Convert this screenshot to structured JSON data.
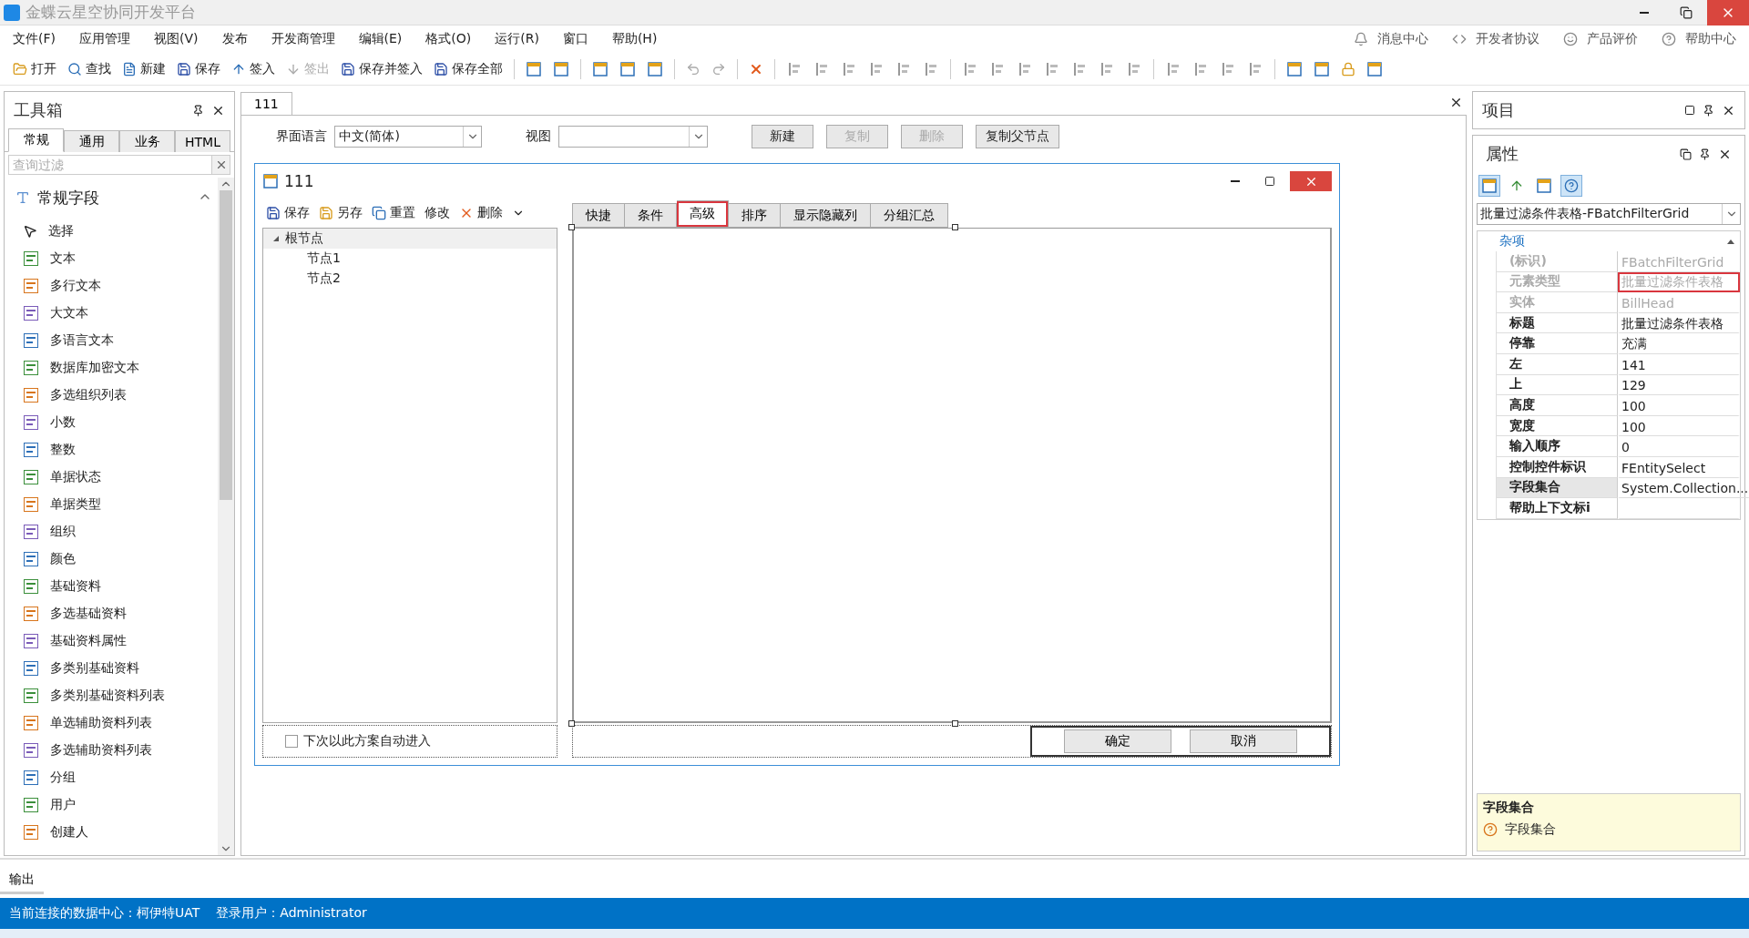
{
  "window": {
    "title": "金蝶云星空协同开发平台"
  },
  "menu": [
    "文件(F)",
    "应用管理",
    "视图(V)",
    "发布",
    "开发商管理",
    "编辑(E)",
    "格式(O)",
    "运行(R)",
    "窗口",
    "帮助(H)"
  ],
  "header_links": [
    {
      "kind": "bell",
      "label": "消息中心"
    },
    {
      "kind": "code",
      "label": "开发者协议"
    },
    {
      "kind": "smile",
      "label": "产品评价"
    },
    {
      "kind": "help",
      "label": "帮助中心"
    }
  ],
  "toolbar": [
    {
      "kind": "open",
      "label": "打开",
      "disabled": false
    },
    {
      "kind": "search",
      "label": "查找",
      "disabled": false
    },
    {
      "kind": "new",
      "label": "新建",
      "disabled": false
    },
    {
      "kind": "save",
      "label": "保存",
      "disabled": false
    },
    {
      "kind": "checkin",
      "label": "签入",
      "disabled": false
    },
    {
      "kind": "checkout",
      "label": "签出",
      "disabled": true
    },
    {
      "kind": "save",
      "label": "保存并签入",
      "disabled": false
    },
    {
      "kind": "save",
      "label": "保存全部",
      "disabled": false
    },
    {
      "kind": "separator"
    },
    {
      "kind": "icon",
      "disabled": false
    },
    {
      "kind": "icon",
      "disabled": false
    },
    {
      "kind": "separator"
    },
    {
      "kind": "icon",
      "disabled": false
    },
    {
      "kind": "icon",
      "disabled": false
    },
    {
      "kind": "icon",
      "disabled": false
    },
    {
      "kind": "separator"
    },
    {
      "kind": "undo",
      "disabled": true
    },
    {
      "kind": "redo",
      "disabled": true
    },
    {
      "kind": "separator"
    },
    {
      "kind": "delete",
      "disabled": false
    },
    {
      "kind": "separator"
    },
    {
      "kind": "align",
      "disabled": true
    },
    {
      "kind": "align",
      "disabled": true
    },
    {
      "kind": "align",
      "disabled": true
    },
    {
      "kind": "align",
      "disabled": true
    },
    {
      "kind": "align",
      "disabled": true
    },
    {
      "kind": "align",
      "disabled": true
    },
    {
      "kind": "separator"
    },
    {
      "kind": "align",
      "disabled": true
    },
    {
      "kind": "align",
      "disabled": true
    },
    {
      "kind": "align",
      "disabled": true
    },
    {
      "kind": "align",
      "disabled": true
    },
    {
      "kind": "align",
      "disabled": true
    },
    {
      "kind": "align",
      "disabled": true
    },
    {
      "kind": "align",
      "disabled": true
    },
    {
      "kind": "separator"
    },
    {
      "kind": "align",
      "disabled": true
    },
    {
      "kind": "align",
      "disabled": true
    },
    {
      "kind": "align",
      "disabled": true
    },
    {
      "kind": "align",
      "disabled": true
    },
    {
      "kind": "separator"
    },
    {
      "kind": "icon",
      "disabled": false
    },
    {
      "kind": "icon",
      "disabled": false
    },
    {
      "kind": "lock",
      "disabled": false
    },
    {
      "kind": "icon",
      "disabled": false
    }
  ],
  "toolbox": {
    "title": "工具箱",
    "tabs": [
      {
        "label": "常规",
        "selected": true
      },
      {
        "label": "通用",
        "selected": false
      },
      {
        "label": "业务",
        "selected": false
      },
      {
        "label": "HTML",
        "selected": false
      }
    ],
    "search": {
      "placeholder": "查询过滤"
    },
    "group": {
      "label": "常规字段",
      "expanded": true
    },
    "items": [
      "选择",
      "文本",
      "多行文本",
      "大文本",
      "多语言文本",
      "数据库加密文本",
      "多选组织列表",
      "小数",
      "整数",
      "单据状态",
      "单据类型",
      "组织",
      "颜色",
      "基础资料",
      "多选基础资料",
      "基础资料属性",
      "多类别基础资料",
      "多类别基础资料列表",
      "单选辅助资料列表",
      "多选辅助资料列表",
      "分组",
      "用户",
      "创建人"
    ]
  },
  "document_tab": {
    "label": "111"
  },
  "designer": {
    "language_label": "界面语言",
    "language_value": "中文(简体)",
    "view_label": "视图",
    "buttons": [
      {
        "label": "新建",
        "disabled": false
      },
      {
        "label": "复制",
        "disabled": true
      },
      {
        "label": "删除",
        "disabled": true
      },
      {
        "label": "复制父节点",
        "disabled": false
      }
    ]
  },
  "form": {
    "title": "111",
    "toolbar": [
      {
        "kind": "save",
        "label": "保存"
      },
      {
        "kind": "saveas",
        "label": "另存"
      },
      {
        "kind": "reset",
        "label": "重置"
      },
      {
        "kind": "plain",
        "label": "修改"
      },
      {
        "kind": "delete",
        "label": "删除"
      }
    ],
    "tree": {
      "label": "根节点",
      "expanded": true,
      "children": [
        {
          "label": "节点1"
        },
        {
          "label": "节点2"
        }
      ]
    },
    "tabs": [
      {
        "label": "快捷",
        "selected": false,
        "highlighted": false
      },
      {
        "label": "条件",
        "selected": false,
        "highlighted": false
      },
      {
        "label": "高级",
        "selected": true,
        "highlighted": true
      },
      {
        "label": "排序",
        "selected": false,
        "highlighted": false
      },
      {
        "label": "显示隐藏列",
        "selected": false,
        "highlighted": false
      },
      {
        "label": "分组汇总",
        "selected": false,
        "highlighted": false
      }
    ],
    "auto_enter": {
      "label": "下次以此方案自动进入",
      "checked": false
    },
    "buttons": [
      "确定",
      "取消"
    ]
  },
  "projects_panel": {
    "title": "项目"
  },
  "properties": {
    "title": "属性",
    "object": "批量过滤条件表格-FBatchFilterGrid",
    "category": {
      "label": "杂项",
      "expanded": true
    },
    "rows": [
      {
        "name": "(标识)",
        "value": "FBatchFilterGrid",
        "readonly": true,
        "selected": false,
        "highlighted": false
      },
      {
        "name": "元素类型",
        "value": "批量过滤条件表格",
        "readonly": true,
        "selected": false,
        "highlighted": true
      },
      {
        "name": "实体",
        "value": "BillHead",
        "readonly": true,
        "selected": false,
        "highlighted": false
      },
      {
        "name": "标题",
        "value": "批量过滤条件表格",
        "readonly": false,
        "selected": false,
        "highlighted": false
      },
      {
        "name": "停靠",
        "value": "充满",
        "readonly": false,
        "selected": false,
        "highlighted": false
      },
      {
        "name": "左",
        "value": "141",
        "readonly": false,
        "selected": false,
        "highlighted": false
      },
      {
        "name": "上",
        "value": "129",
        "readonly": false,
        "selected": false,
        "highlighted": false
      },
      {
        "name": "高度",
        "value": "100",
        "readonly": false,
        "selected": false,
        "highlighted": false
      },
      {
        "name": "宽度",
        "value": "100",
        "readonly": false,
        "selected": false,
        "highlighted": false
      },
      {
        "name": "输入顺序",
        "value": "0",
        "readonly": false,
        "selected": false,
        "highlighted": false
      },
      {
        "name": "控制控件标识",
        "value": "FEntitySelect",
        "readonly": false,
        "selected": false,
        "highlighted": false
      },
      {
        "name": "字段集合",
        "value": "System.Collection...",
        "readonly": false,
        "selected": true,
        "highlighted": false
      },
      {
        "name": "帮助上下文标i",
        "value": "",
        "readonly": false,
        "selected": false,
        "highlighted": false
      }
    ],
    "help": {
      "title": "字段集合",
      "text": "字段集合"
    }
  },
  "output_tab": {
    "label": "输出"
  },
  "status_bar": {
    "connection": "当前连接的数据中心：柯伊特UAT",
    "user": "登录用户：Administrator"
  }
}
